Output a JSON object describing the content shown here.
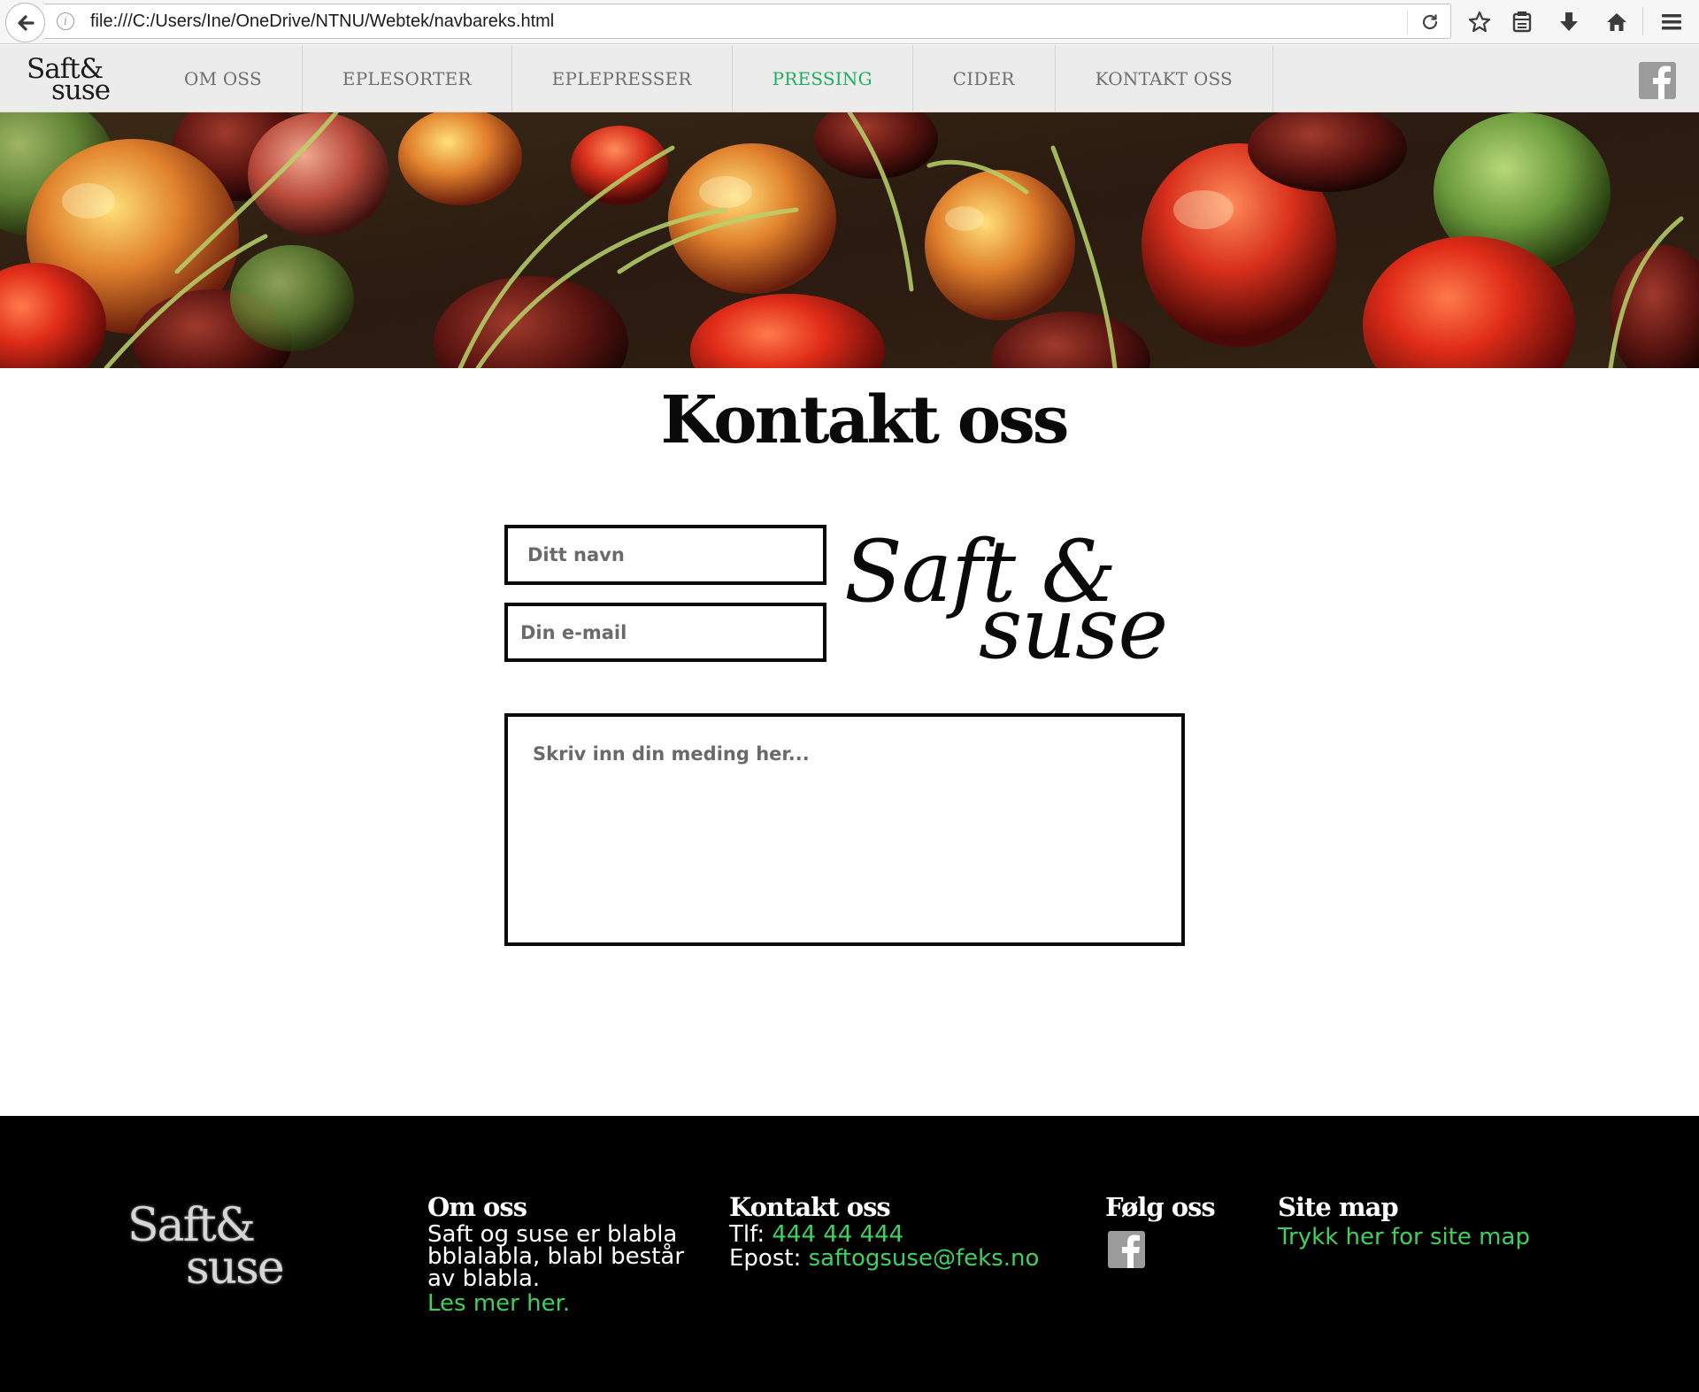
{
  "browser": {
    "url": "file:///C:/Users/Ine/OneDrive/NTNU/Webtek/navbareks.html",
    "info_icon_glyph": "i"
  },
  "navbar": {
    "logo_line1": "Saft&",
    "logo_line2": "suse",
    "items": [
      {
        "label": "OM OSS"
      },
      {
        "label": "EPLESORTER"
      },
      {
        "label": "EPLEPRESSER"
      },
      {
        "label": "PRESSING"
      },
      {
        "label": "CIDER"
      },
      {
        "label": "KONTAKT OSS"
      }
    ],
    "active_color": "#1fae5f",
    "facebook_icon": "facebook-icon"
  },
  "main": {
    "title": "Kontakt oss",
    "name_placeholder": "Ditt navn",
    "email_placeholder": "Din e-mail",
    "message_placeholder": "Skriv inn din meding her...",
    "logo_line1": "Saft &",
    "logo_line2": "suse"
  },
  "footer": {
    "logo_line1": "Saft&",
    "logo_line2": "suse",
    "om_oss": {
      "heading": "Om oss",
      "text": "Saft og suse er blabla bblalabla, blabl består av blabla.",
      "link": "Les mer her."
    },
    "kontakt": {
      "heading": "Kontakt oss",
      "phone_label": "Tlf: ",
      "phone": "444 44 444",
      "email_label": "Epost: ",
      "email": "saftogsuse@feks.no"
    },
    "folg": {
      "heading": "Følg oss",
      "icon": "facebook-icon"
    },
    "site_map": {
      "heading": "Site map",
      "link": "Trykk her for site map"
    },
    "link_color": "#3fd15f"
  }
}
